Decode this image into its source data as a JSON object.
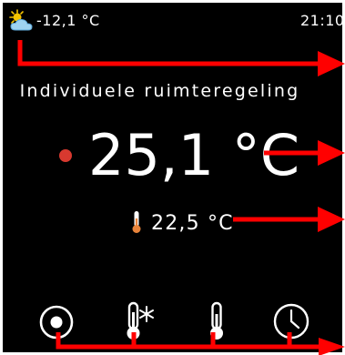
{
  "status": {
    "outdoor_temp": "-12,1 °C",
    "time": "21:10",
    "weather_icon": "partly-cloudy-icon"
  },
  "main": {
    "title": "Individuele ruimteregeling",
    "setpoint": "25,1 °C",
    "actual_temp": "22,5 °C",
    "state_dot_color": "#d8392f"
  },
  "nav": {
    "items": [
      {
        "icon": "radio-record-icon"
      },
      {
        "icon": "thermometer-snowflake-icon"
      },
      {
        "icon": "thermometer-icon"
      },
      {
        "icon": "clock-icon"
      }
    ]
  },
  "annotation_color": "#ff0000",
  "colors": {
    "background": "#000000",
    "text": "#ffffff",
    "thermometer_fill": "#e8833a",
    "sun": "#f5c400",
    "cloud": "#9fd3f0"
  }
}
